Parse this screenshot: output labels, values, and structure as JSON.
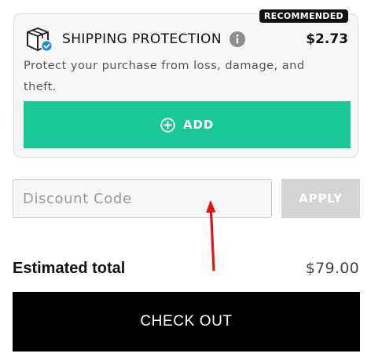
{
  "shipping_protection": {
    "badge": "RECOMMENDED",
    "title": "SHIPPING PROTECTION",
    "price": "$2.73",
    "description": "Protect your purchase from loss, damage, and theft.",
    "add_label": "ADD",
    "icons": {
      "product": "shipping-box-shield-icon",
      "info": "info-icon",
      "add": "plus-circle-icon"
    },
    "accent_color": "#1bc796"
  },
  "discount": {
    "placeholder": "Discount Code",
    "value": "",
    "apply_label": "APPLY"
  },
  "summary": {
    "total_label": "Estimated total",
    "total_value": "$79.00"
  },
  "checkout": {
    "label": "CHECK OUT",
    "color": "#000000"
  },
  "annotation": {
    "type": "arrow",
    "color": "#e0141b"
  }
}
